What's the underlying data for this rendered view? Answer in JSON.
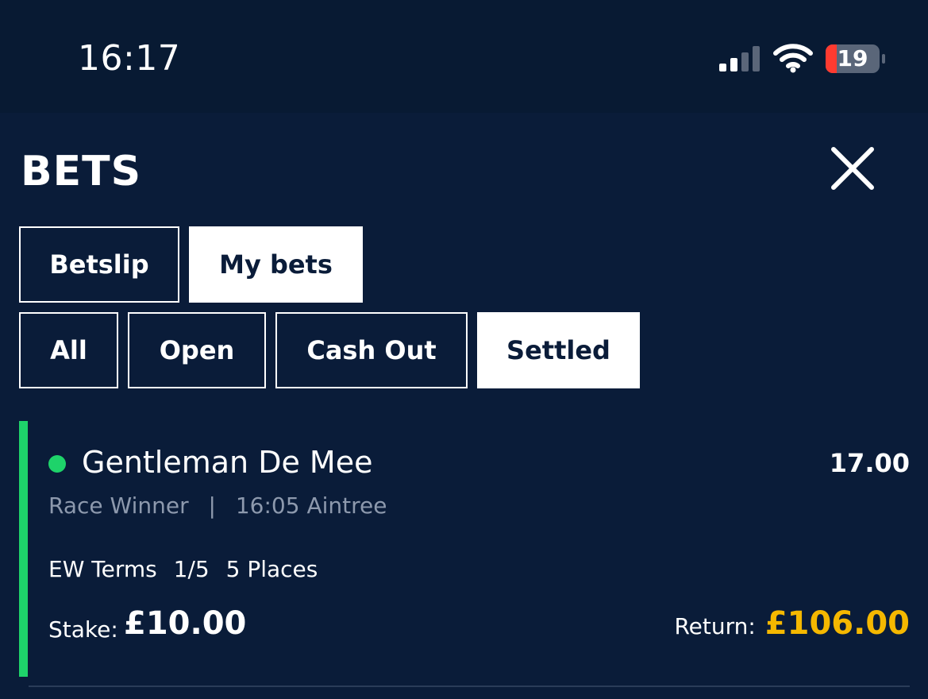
{
  "status_bar": {
    "time": "16:17",
    "battery": "19"
  },
  "header": {
    "title": "BETS"
  },
  "tabs": [
    {
      "label": "Betslip",
      "active": false
    },
    {
      "label": "My bets",
      "active": true
    }
  ],
  "filters": [
    {
      "label": "All",
      "active": false
    },
    {
      "label": "Open",
      "active": false
    },
    {
      "label": "Cash Out",
      "active": false
    },
    {
      "label": "Settled",
      "active": true
    }
  ],
  "bet": {
    "selection": "Gentleman De Mee",
    "odds": "17.00",
    "market": "Race Winner",
    "separator": "|",
    "event": "16:05 Aintree",
    "ew_label": "EW Terms",
    "ew_fraction": "1/5",
    "ew_places": "5 Places",
    "stake_label": "Stake:",
    "stake_value": "£10.00",
    "return_label": "Return:",
    "return_value": "£106.00"
  },
  "colors": {
    "background": "#081a33",
    "panel": "#0a1c39",
    "win_green": "#1ed36a",
    "return_gold": "#f5b800",
    "muted_text": "#8d99ad"
  },
  "icons": {
    "close": "close-icon",
    "signal": "cellular-signal-icon",
    "wifi": "wifi-icon",
    "battery": "battery-icon",
    "status": "status-dot"
  }
}
